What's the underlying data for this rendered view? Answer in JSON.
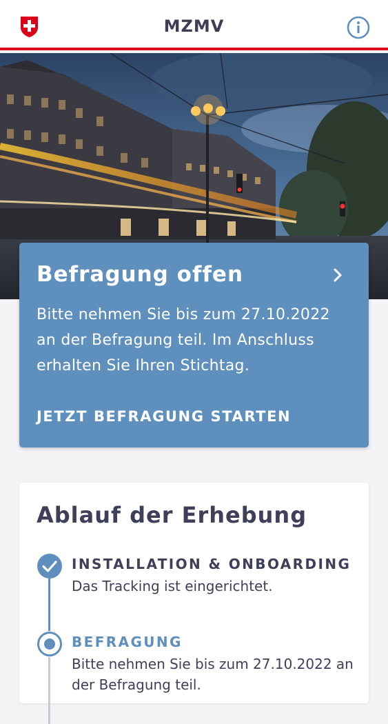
{
  "appbar": {
    "title": "MZMV",
    "logo": "swiss-cross",
    "info_icon": "info-icon",
    "accent_color": "#dc0018"
  },
  "hero": {
    "image": "night-street-scene"
  },
  "survey_card": {
    "title": "Befragung offen",
    "text": "Bitte nehmen Sie bis zum 27.10.2022 an der Befragung teil. Im Anschluss erhalten Sie Ihren Stichtag.",
    "cta": "JETZT BEFRAGUNG STARTEN",
    "color": "#5f8fbd"
  },
  "process_card": {
    "title": "Ablauf der Erhebung",
    "steps": [
      {
        "label": "INSTALLATION & ONBOARDING",
        "description": "Das Tracking ist eingerichtet.",
        "state": "done"
      },
      {
        "label": "BEFRAGUNG",
        "description": "Bitte nehmen Sie bis zum 27.10.2022 an der Befragung teil.",
        "state": "current"
      }
    ]
  }
}
